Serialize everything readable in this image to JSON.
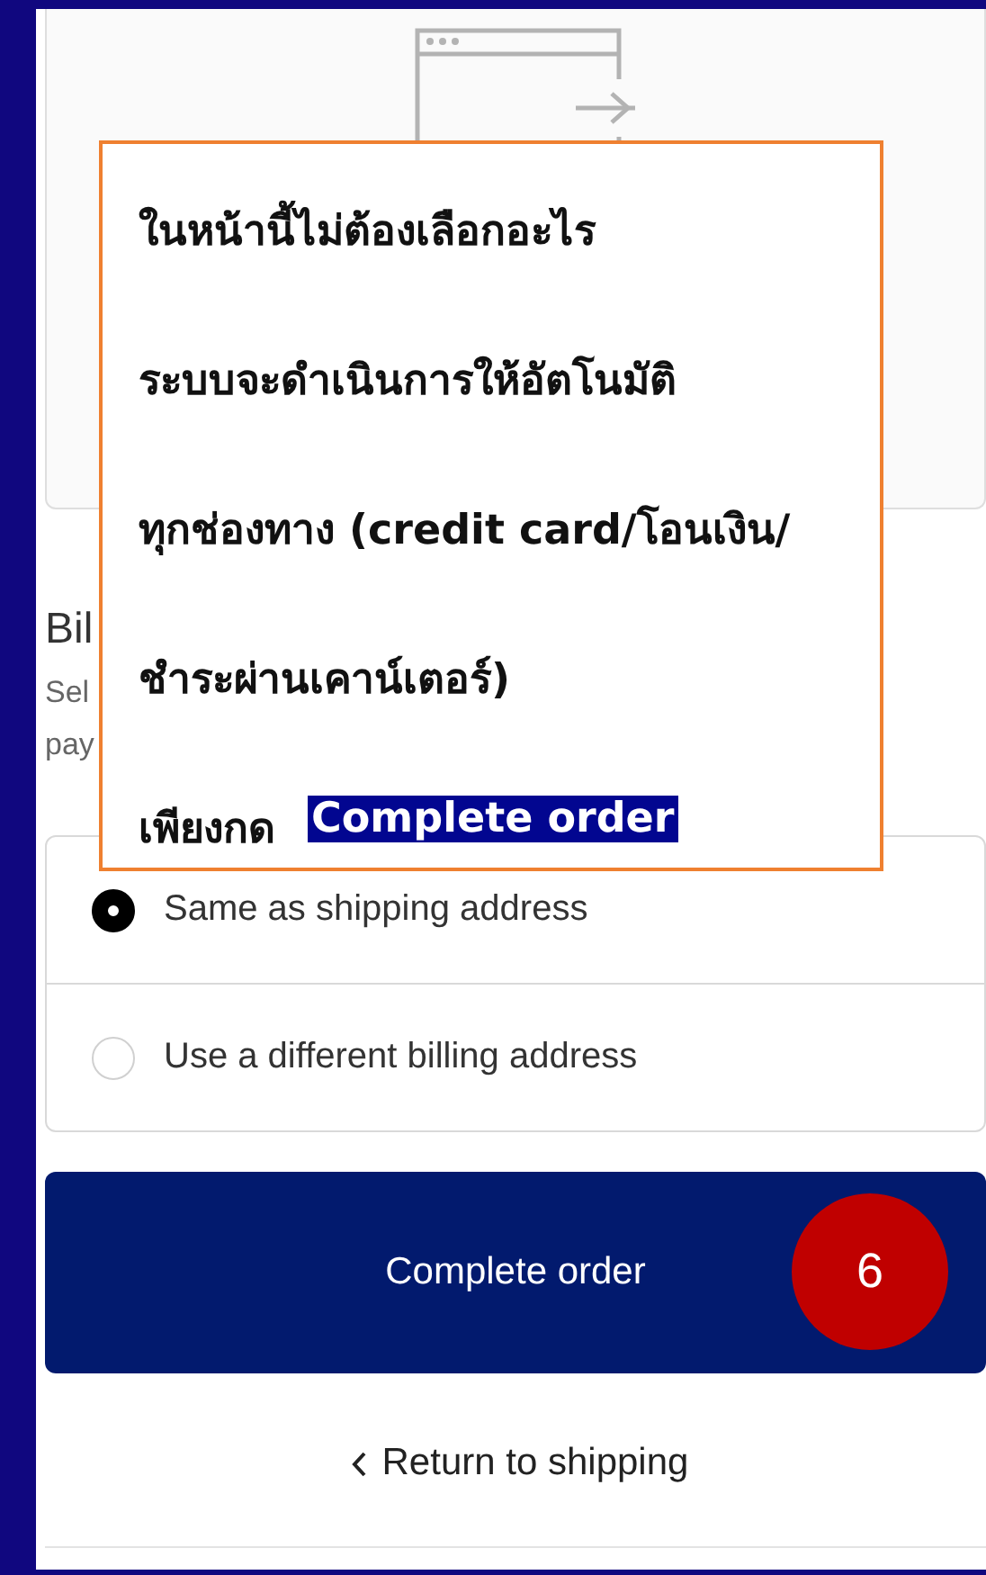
{
  "billing": {
    "heading": "Bil",
    "description_lines": [
      "Sel",
      "pay"
    ]
  },
  "billing_options": [
    {
      "label": "Same as shipping address",
      "selected": true
    },
    {
      "label": "Use a different billing address",
      "selected": false
    }
  ],
  "complete_button": {
    "label": "Complete order"
  },
  "step_badge": "6",
  "return_link": {
    "label": "Return to shipping"
  },
  "callout": {
    "lines": [
      {
        "text": "ในหน้านี้ไม่ต้องเลือกอะไร"
      },
      {
        "text": "ระบบจะดำเนินการให้อัตโนมัติ"
      },
      {
        "text": "ทุกช่องทาง (credit card/โอนเงิน/"
      },
      {
        "text": "ชำระผ่านเคาน์เตอร์)"
      },
      {
        "text": "เพียงกด",
        "highlight": "Complete order"
      }
    ]
  }
}
